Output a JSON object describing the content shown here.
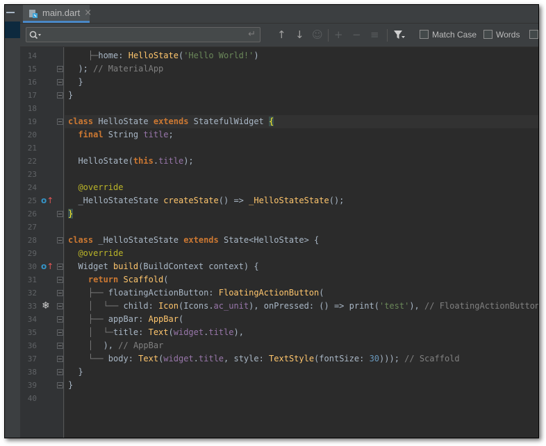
{
  "tab": {
    "filename": "main.dart",
    "close": "×"
  },
  "find": {
    "placeholder": "",
    "match_case_label": "Match Case",
    "words_label": "Words"
  },
  "lines": [
    {
      "n": "14",
      "segs": [
        [
          "guide",
          "    ├─"
        ],
        [
          "",
          "home: "
        ],
        [
          "fn",
          "HelloState"
        ],
        [
          "",
          "("
        ],
        [
          "st",
          "'Hello World!'"
        ],
        [
          "",
          ")"
        ]
      ]
    },
    {
      "n": "15",
      "segs": [
        [
          "",
          "  ); "
        ],
        [
          "cm",
          "// MaterialApp"
        ]
      ]
    },
    {
      "n": "16",
      "segs": [
        [
          "",
          "  }"
        ]
      ]
    },
    {
      "n": "17",
      "segs": [
        [
          "",
          "}"
        ]
      ]
    },
    {
      "n": "18",
      "segs": []
    },
    {
      "n": "19",
      "segs": [
        [
          "kw",
          "class "
        ],
        [
          "",
          "HelloState "
        ],
        [
          "kw",
          "extends "
        ],
        [
          "",
          "StatefulWidget "
        ],
        [
          "brace",
          "{"
        ]
      ]
    },
    {
      "n": "20",
      "segs": [
        [
          "kw",
          "  final "
        ],
        [
          "",
          "String "
        ],
        [
          "fd",
          "title"
        ],
        [
          "",
          ";"
        ]
      ]
    },
    {
      "n": "21",
      "segs": []
    },
    {
      "n": "22",
      "segs": [
        [
          "",
          "  HelloState("
        ],
        [
          "kw",
          "this"
        ],
        [
          "",
          "."
        ],
        [
          "fd",
          "title"
        ],
        [
          "",
          ");"
        ]
      ]
    },
    {
      "n": "23",
      "segs": []
    },
    {
      "n": "24",
      "segs": [
        [
          "an",
          "  @override"
        ]
      ]
    },
    {
      "n": "25",
      "segs": [
        [
          "",
          "  _HelloStateState "
        ],
        [
          "fn",
          "createState"
        ],
        [
          "",
          "() => "
        ],
        [
          "fn",
          "_HelloStateState"
        ],
        [
          "",
          "();"
        ]
      ]
    },
    {
      "n": "26",
      "segs": [
        [
          "brace",
          "}"
        ]
      ]
    },
    {
      "n": "27",
      "segs": []
    },
    {
      "n": "28",
      "segs": [
        [
          "kw",
          "class "
        ],
        [
          "",
          "_HelloStateState "
        ],
        [
          "kw",
          "extends "
        ],
        [
          "",
          "State<HelloState> {"
        ]
      ]
    },
    {
      "n": "29",
      "segs": [
        [
          "an",
          "  @override"
        ]
      ]
    },
    {
      "n": "30",
      "segs": [
        [
          "",
          "  Widget "
        ],
        [
          "fn",
          "build"
        ],
        [
          "",
          "(BuildContext context) {"
        ]
      ]
    },
    {
      "n": "31",
      "segs": [
        [
          "kw",
          "    return "
        ],
        [
          "fn",
          "Scaffold"
        ],
        [
          "",
          "("
        ]
      ]
    },
    {
      "n": "32",
      "segs": [
        [
          "guide",
          "    ├── "
        ],
        [
          "",
          "floatingActionButton: "
        ],
        [
          "fn",
          "FloatingActionButton"
        ],
        [
          "",
          "("
        ]
      ]
    },
    {
      "n": "33",
      "segs": [
        [
          "guide",
          "    │  └── "
        ],
        [
          "",
          "child: "
        ],
        [
          "fn",
          "Icon"
        ],
        [
          "",
          "(Icons."
        ],
        [
          "fd",
          "ac_unit"
        ],
        [
          "",
          "), onPressed: () => print("
        ],
        [
          "st",
          "'test'"
        ],
        [
          "",
          "), "
        ],
        [
          "cm",
          "// FloatingActionButton"
        ]
      ]
    },
    {
      "n": "34",
      "segs": [
        [
          "guide",
          "    ├── "
        ],
        [
          "",
          "appBar: "
        ],
        [
          "fn",
          "AppBar"
        ],
        [
          "",
          "("
        ]
      ]
    },
    {
      "n": "35",
      "segs": [
        [
          "guide",
          "    │  └─"
        ],
        [
          "",
          "title: "
        ],
        [
          "fn",
          "Text"
        ],
        [
          "",
          "("
        ],
        [
          "fd",
          "widget"
        ],
        [
          "",
          "."
        ],
        [
          "fd",
          "title"
        ],
        [
          "",
          "),"
        ]
      ]
    },
    {
      "n": "36",
      "segs": [
        [
          "guide",
          "    │  "
        ],
        [
          "",
          "), "
        ],
        [
          "cm",
          "// AppBar"
        ]
      ]
    },
    {
      "n": "37",
      "segs": [
        [
          "guide",
          "    └── "
        ],
        [
          "",
          "body: "
        ],
        [
          "fn",
          "Text"
        ],
        [
          "",
          "("
        ],
        [
          "fd",
          "widget"
        ],
        [
          "",
          "."
        ],
        [
          "fd",
          "title"
        ],
        [
          "",
          ", style: "
        ],
        [
          "fn",
          "TextStyle"
        ],
        [
          "",
          "(fontSize: "
        ],
        [
          "nu",
          "30"
        ],
        [
          "",
          ")));"
        ],
        [
          "cm",
          " // Scaffold"
        ]
      ]
    },
    {
      "n": "38",
      "segs": [
        [
          "",
          "  }"
        ]
      ]
    },
    {
      "n": "39",
      "segs": [
        [
          "",
          "}"
        ]
      ]
    },
    {
      "n": "40",
      "segs": []
    }
  ]
}
